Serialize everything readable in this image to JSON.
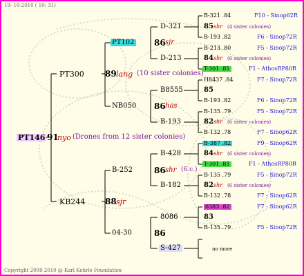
{
  "header": {
    "date": "19- 10-2010 ( 10: 31)"
  },
  "footer": {
    "copyright": "Copyright 2008-2010 @ Karl Kehrle Foundation"
  },
  "colors": {
    "border": "#ff00cc",
    "background": "#fffce8",
    "cyan": "#33dddd",
    "green": "#44dd44",
    "pink": "#dd44cc",
    "lilac": "#eeccff",
    "lavender": "#ddddff"
  },
  "root": {
    "code": "PT146",
    "num": "91",
    "race": "nyo",
    "note": "(Drones from 12 sister colonies)"
  },
  "gen1": {
    "father": {
      "code": "PT300",
      "num": "89",
      "race": "lang",
      "note": "(10 sister colonies)"
    },
    "mother": {
      "code": "KB244",
      "num": "88",
      "race": "sjr"
    }
  },
  "gen2": {
    "pt102": {
      "code": "PT102",
      "num": "86",
      "race": "sjr"
    },
    "nb050": {
      "code": "NB050",
      "num": "86",
      "race": "has"
    },
    "b252": {
      "code": "B-252",
      "num": "86",
      "race": "shr",
      "note": "(6 c.)"
    },
    "w0430": {
      "code": "04-30",
      "num": "86"
    }
  },
  "gen3": [
    "D-321",
    "D-213",
    "B8555",
    "B-193",
    "B-428",
    "B-182",
    "8086",
    "S-427"
  ],
  "gen4": [
    {
      "code": "B-321 .84",
      "src": "F10 - Sinop62R"
    },
    {
      "num": "85",
      "race": "shr",
      "note": "(4 sister colonies)"
    },
    {
      "code": "B-193 .82",
      "src": "F6 - Sinop72R"
    },
    {
      "code": "B-213 .80",
      "src": "F5 - Sinop72R"
    },
    {
      "num": "84",
      "race": "shr",
      "note": "(6 sister colonies)"
    },
    {
      "code": "T-301 .81",
      "src": "F1 - AthosRP80R"
    },
    {
      "code": "H8437 .84",
      "src": "F7 - Sinop72R"
    },
    {
      "num": "85"
    },
    {
      "code": "B-193 .82",
      "src": "F6 - Sinop72R"
    },
    {
      "code": "B-135 .79",
      "src": "F5 - Sinop72R"
    },
    {
      "num": "82",
      "race": "shr",
      "note": "(6 sister colonies)"
    },
    {
      "code": "B-132 .78",
      "src": "F7 - Sinop62R"
    },
    {
      "code": "B-387 .82",
      "src": "F9 - Sinop62R"
    },
    {
      "num": "84",
      "race": "shr",
      "note": "(6 sister colonies)"
    },
    {
      "code": "T-301 .81",
      "src": "F1 - AthosRP80R"
    },
    {
      "code": "B-135 .79",
      "src": "F5 - Sinop72R"
    },
    {
      "num": "82",
      "race": "shr",
      "note": "(6 sister colonies)"
    },
    {
      "code": "B-132 .78",
      "src": "F7 - Sinop62R"
    },
    {
      "code": "6383 .82",
      "src": "F7 - Sinop62R"
    },
    {
      "num": "83"
    },
    {
      "code": "B-135 .79",
      "src": "F5 - Sinop72R"
    },
    {
      "note": "no more"
    }
  ]
}
